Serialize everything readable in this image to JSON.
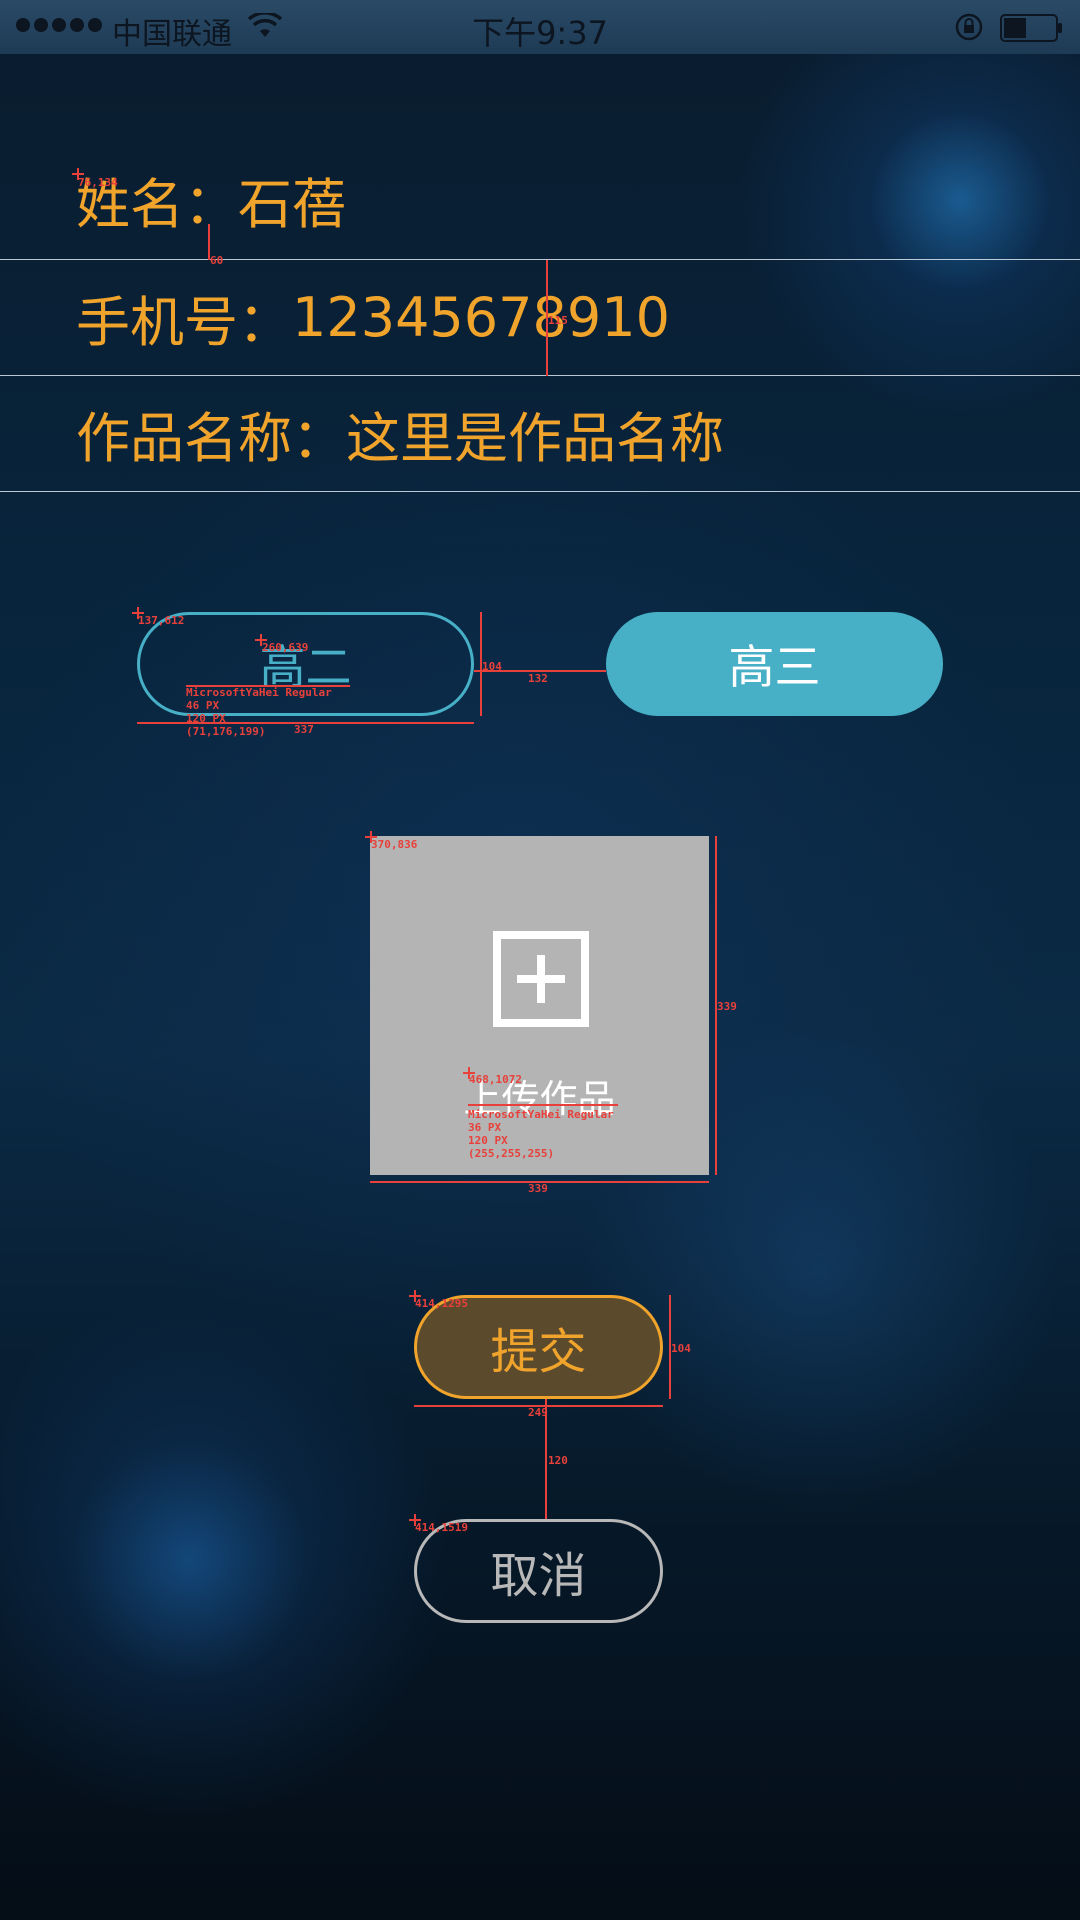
{
  "status_bar": {
    "carrier": "中国联通",
    "time": "下午9:37",
    "icons": [
      "signal-dots-icon",
      "wifi-icon",
      "lock-rotation-icon",
      "battery-icon"
    ]
  },
  "form": {
    "name": {
      "label": "姓名：",
      "value": "石蓓"
    },
    "phone": {
      "label": "手机号：",
      "value": "12345678910"
    },
    "work_title": {
      "label": "作品名称：",
      "value": "这里是作品名称"
    }
  },
  "grades": {
    "grade_2": {
      "label": "高二",
      "selected": false
    },
    "grade_3": {
      "label": "高三",
      "selected": true
    }
  },
  "upload": {
    "label": "上传作品",
    "icon": "plus-square-icon"
  },
  "actions": {
    "submit": "提交",
    "cancel": "取消"
  },
  "colors": {
    "accent_orange": "#f0a42c",
    "accent_teal": "#47b0c7",
    "upload_gray": "#b4b4b4",
    "annotation_red": "#e8403a"
  },
  "annotations": {
    "name_pos": "76,134",
    "name_gap": "60",
    "row_height": "115",
    "grade2_pos": "137,612",
    "grade2_text_pos": "260,639",
    "grade2_font": "MicrosoftYaHei Regular",
    "grade2_size": "46 PX",
    "grade2_lh": "120 PX",
    "grade2_color": "(71,176,199)",
    "grade_btn_width": "337",
    "grade_btn_height": "104",
    "grade_gap": "132",
    "upload_pos": "370,836",
    "upload_height": "339",
    "upload_width": "339",
    "upload_text_pos": "468,1072",
    "upload_font": "MicrosoftYaHei Regular",
    "upload_size": "36 PX",
    "upload_lh": "120 PX",
    "upload_color": "(255,255,255)",
    "submit_pos": "414,1295",
    "submit_height": "104",
    "submit_width": "249",
    "btn_gap": "120",
    "cancel_pos": "414,1519"
  }
}
